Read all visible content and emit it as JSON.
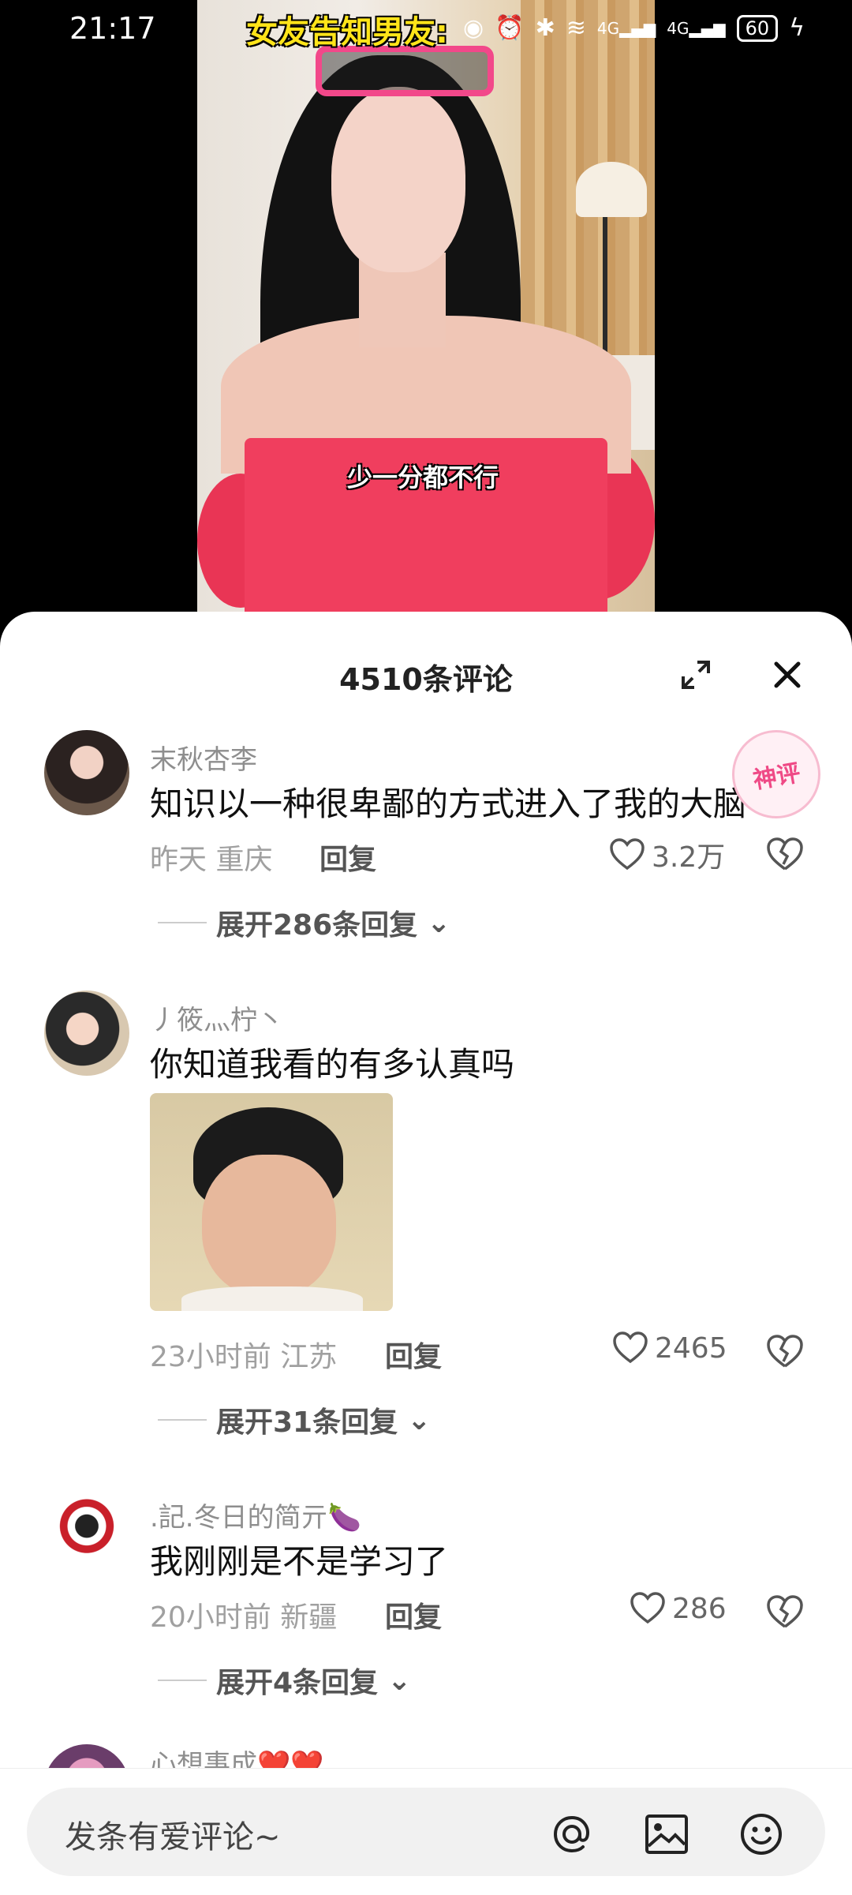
{
  "status_bar": {
    "time": "21:17",
    "signal_1": "4G",
    "signal_2": "4G",
    "battery": "60"
  },
  "video": {
    "caption_top": "女友告知男友:",
    "caption_subtitle": "少一分都不行"
  },
  "comments_sheet": {
    "title": "4510条评论",
    "comments": [
      {
        "username": "末秋杏李",
        "text": "知识以一种很卑鄙的方式进入了我的大脑",
        "time": "昨天",
        "location": "重庆",
        "reply_label": "回复",
        "likes": "3.2万",
        "expand_label": "展开286条回复",
        "badge": "神评"
      },
      {
        "username": "丿筱灬柠丶",
        "text": "你知道我看的有多认真吗",
        "time": "23小时前",
        "location": "江苏",
        "reply_label": "回复",
        "likes": "2465",
        "expand_label": "展开31条回复"
      },
      {
        "username": ".記.冬日的简亓🍆",
        "text": "我刚刚是不是学习了",
        "time": "20小时前",
        "location": "新疆",
        "reply_label": "回复",
        "likes": "286",
        "expand_label": "展开4条回复"
      },
      {
        "username": "心想事成❤️❤️"
      }
    ]
  },
  "input_bar": {
    "placeholder": "发条有爱评论~"
  }
}
